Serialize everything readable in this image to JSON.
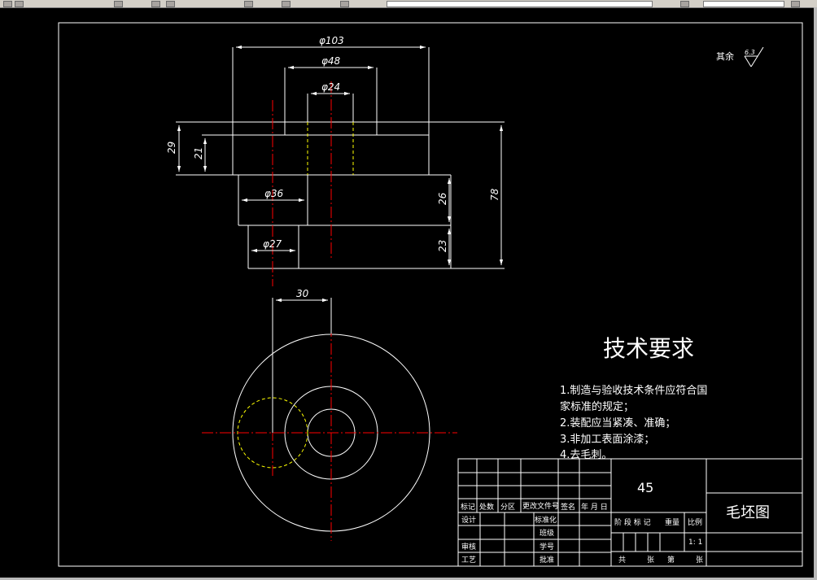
{
  "drawing": {
    "part_dimensions": {
      "dia_103": "φ103",
      "dia_48": "φ48",
      "dia_24": "φ24",
      "dia_36": "φ36",
      "dia_27": "φ27",
      "h_29": "29",
      "h_21": "21",
      "h_26": "26",
      "h_23": "23",
      "h_78": "78",
      "offset_30": "30"
    },
    "roughness": {
      "label": "其余",
      "value": "6.3"
    },
    "requirements": {
      "title": "技术要求",
      "items": [
        "1.制造与验收技术条件应符合国",
        "家标准的规定；",
        "2.装配应当紧凑、准确；",
        "3.非加工表面涂漆；",
        "4.去毛刺。"
      ]
    },
    "title_block": {
      "material": "45",
      "drawing_name": "毛坯图",
      "scale": "1: 1",
      "header_row": [
        "标记",
        "处数",
        "分区",
        "更改文件号",
        "签名",
        "年  月  日"
      ],
      "left_labels": [
        "设计",
        "审核",
        "工艺"
      ],
      "mid_labels": [
        "标准化",
        "班级",
        "学号",
        "批准"
      ],
      "stage_labels": {
        "stage": "阶 段 标 记",
        "weight": "重量",
        "scale": "比例"
      },
      "sheet_labels": [
        "共",
        "张",
        "第",
        "张"
      ]
    },
    "colors": {
      "background": "#000000",
      "lines": "#ffffff",
      "centerlines": "#ff0000",
      "hidden": "#ffff00"
    }
  }
}
